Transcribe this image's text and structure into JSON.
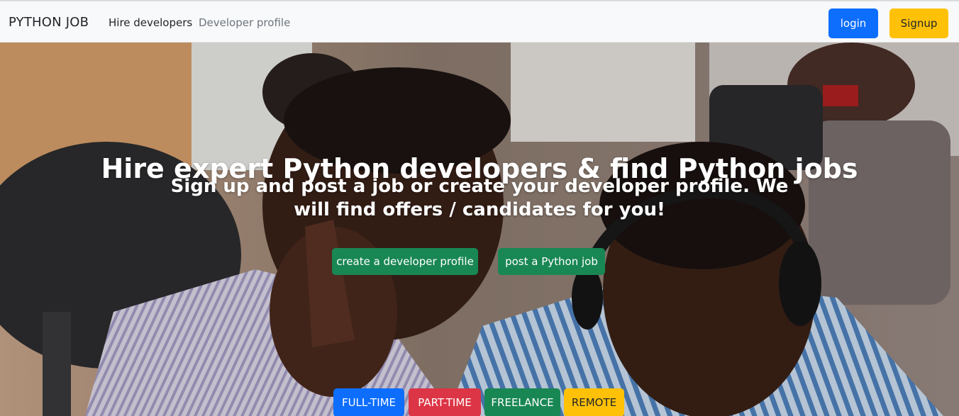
{
  "navbar": {
    "brand": "PYTHON JOB",
    "links": [
      {
        "label": "Hire developers"
      },
      {
        "label": "Developer profile"
      }
    ],
    "login_label": "login",
    "signup_label": "Signup"
  },
  "hero": {
    "title": "Hire expert Python developers & find Python jobs",
    "subtitle": "Sign up and post a job or create your developer profile. We will find offers / candidates for you!",
    "cta": [
      {
        "label": "create a developer profile"
      },
      {
        "label": "post a Python job"
      }
    ],
    "tags": [
      {
        "label": "FULL-TIME"
      },
      {
        "label": "PART-TIME"
      },
      {
        "label": "FREELANCE"
      },
      {
        "label": "REMOTE"
      }
    ]
  },
  "colors": {
    "primary": "#0d6efd",
    "warning": "#ffc107",
    "success": "#198754",
    "danger": "#dc3545"
  }
}
